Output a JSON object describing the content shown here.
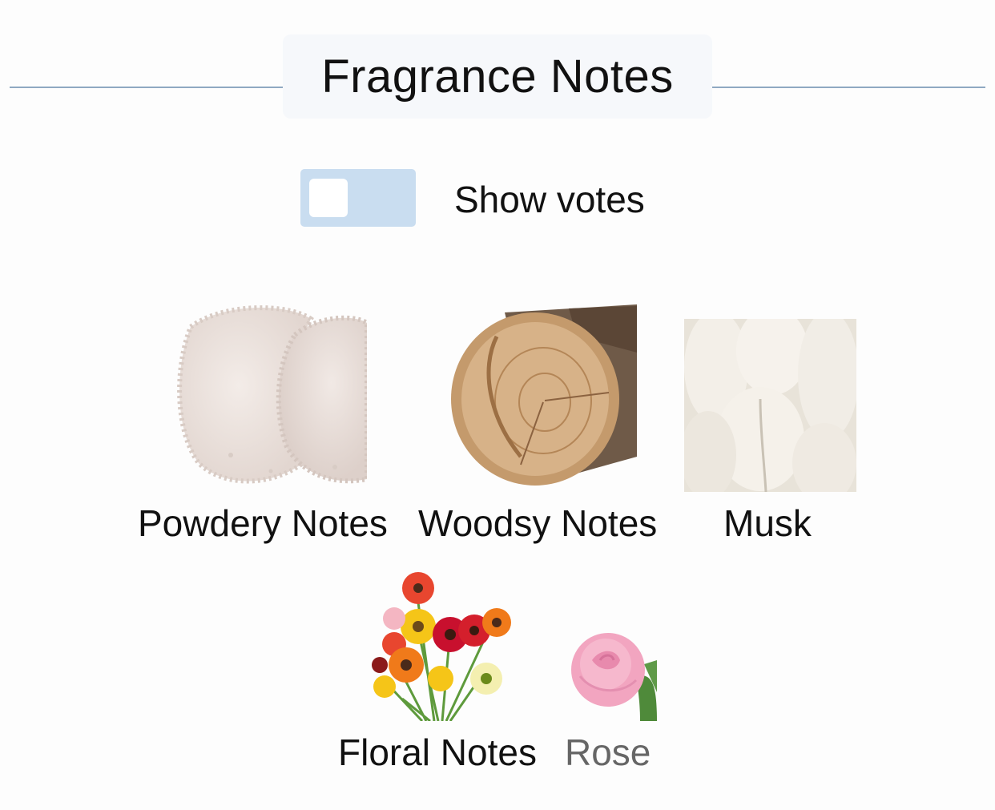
{
  "header": {
    "title": "Fragrance Notes"
  },
  "toggle": {
    "label": "Show votes",
    "state": false,
    "track_color": "#c9ddf0",
    "knob_color": "#ffffff"
  },
  "notes_row1": [
    {
      "name": "Powdery Notes",
      "icon": "powder-icon"
    },
    {
      "name": "Woodsy Notes",
      "icon": "log-icon"
    },
    {
      "name": "Musk",
      "icon": "musk-fluff-icon"
    }
  ],
  "notes_row2": [
    {
      "name": "Floral Notes",
      "icon": "flower-bouquet-icon"
    },
    {
      "name": "Rose",
      "icon": "rose-icon"
    }
  ],
  "colors": {
    "rule": "#8fa9c2",
    "muted_text": "#666666"
  }
}
